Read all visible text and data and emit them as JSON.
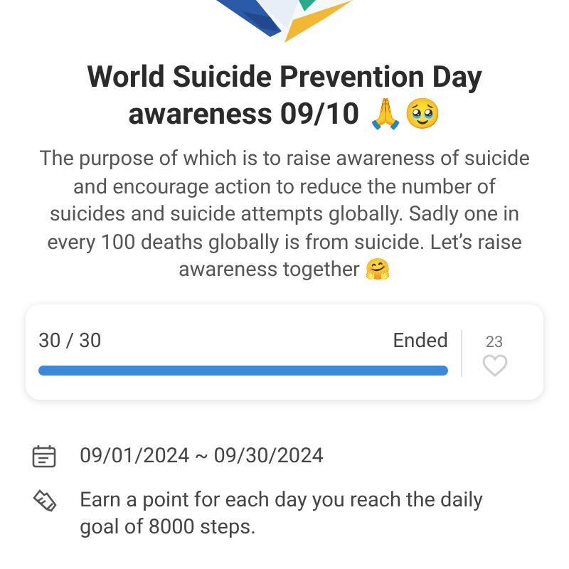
{
  "challenge": {
    "title": "World Suicide Prevention Day awareness 09/10 🙏🥹",
    "description": "The purpose of which is to raise awareness of suicide and encourage action to reduce the number of suicides and suicide attempts globally. Sadly one in every 100 deaths globally is from suicide. Let’s raise awareness together 🤗"
  },
  "progress": {
    "count": "30 / 30",
    "status": "Ended",
    "level": 1,
    "likes": "23",
    "liked": false
  },
  "details": [
    {
      "kind": "calendar",
      "text": "09/01/2024 ~ 09/30/2024"
    },
    {
      "kind": "steps",
      "text": "Earn a point for each day you reach the daily goal of 8000 steps."
    }
  ]
}
